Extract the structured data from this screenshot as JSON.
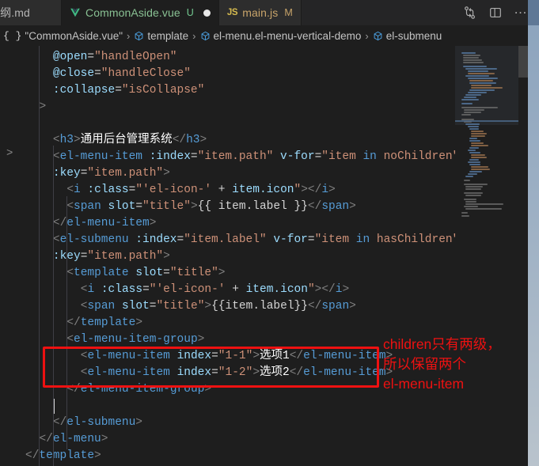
{
  "window": {
    "app": "Visual Studio Code",
    "theme_background": "#1e1e1e",
    "accent_red": "#ee1111"
  },
  "tabs": {
    "items": [
      {
        "label": "大纲.md",
        "icon": "markdown-icon",
        "badge": "",
        "dirty": false,
        "active": false,
        "truncated": true
      },
      {
        "label": "CommonAside.vue",
        "icon": "vue-icon",
        "badge": "U",
        "dirty": true,
        "active": true,
        "truncated": false
      },
      {
        "label": "main.js",
        "icon": "javascript-icon",
        "badge": "M",
        "dirty": false,
        "active": false,
        "truncated": false
      }
    ],
    "actions": [
      {
        "name": "split-editor-icon",
        "glyph": "split"
      },
      {
        "name": "toggle-panel-icon",
        "glyph": "panel"
      },
      {
        "name": "more-actions-icon",
        "glyph": "…"
      }
    ]
  },
  "breadcrumb": {
    "separator": "›",
    "items": [
      {
        "icon": "json-braces-icon",
        "label": "\"CommonAside.vue\""
      },
      {
        "icon": "symbol-module-icon",
        "label": "template"
      },
      {
        "icon": "symbol-module-icon",
        "label": "el-menu.el-menu-vertical-demo"
      },
      {
        "icon": "symbol-module-icon",
        "label": "el-submenu"
      }
    ]
  },
  "editor": {
    "language": "vue",
    "lines": [
      {
        "indent": 4,
        "tokens": [
          {
            "t": "attr",
            "s": "@open"
          },
          {
            "t": "plain",
            "s": "="
          },
          {
            "t": "str",
            "s": "\"handleOpen\""
          }
        ]
      },
      {
        "indent": 4,
        "tokens": [
          {
            "t": "attr",
            "s": "@close"
          },
          {
            "t": "plain",
            "s": "="
          },
          {
            "t": "str",
            "s": "\"handleClose\""
          }
        ]
      },
      {
        "indent": 4,
        "tokens": [
          {
            "t": "attr",
            "s": ":collapse"
          },
          {
            "t": "plain",
            "s": "="
          },
          {
            "t": "str",
            "s": "\"isCollapse\""
          }
        ]
      },
      {
        "indent": 2,
        "tokens": [
          {
            "t": "punc",
            "s": ">"
          }
        ]
      },
      {
        "indent": 0,
        "tokens": []
      },
      {
        "indent": 4,
        "tokens": [
          {
            "t": "punc",
            "s": "<"
          },
          {
            "t": "tag",
            "s": "h3"
          },
          {
            "t": "punc",
            "s": ">"
          },
          {
            "t": "text",
            "s": "通用后台管理系统"
          },
          {
            "t": "punc",
            "s": "</"
          },
          {
            "t": "tag",
            "s": "h3"
          },
          {
            "t": "punc",
            "s": ">"
          }
        ]
      },
      {
        "indent": 4,
        "tokens": [
          {
            "t": "punc",
            "s": "<"
          },
          {
            "t": "tag",
            "s": "el-menu-item"
          },
          {
            "t": "plain",
            "s": " "
          },
          {
            "t": "attr",
            "s": ":index"
          },
          {
            "t": "plain",
            "s": "="
          },
          {
            "t": "str",
            "s": "\"item.path\""
          },
          {
            "t": "plain",
            "s": " "
          },
          {
            "t": "attr",
            "s": "v-for"
          },
          {
            "t": "plain",
            "s": "="
          },
          {
            "t": "str",
            "s": "\"item "
          },
          {
            "t": "tag",
            "s": "in"
          },
          {
            "t": "str",
            "s": " noChildren\""
          }
        ]
      },
      {
        "indent": 4,
        "tokens": [
          {
            "t": "attr",
            "s": ":key"
          },
          {
            "t": "plain",
            "s": "="
          },
          {
            "t": "str",
            "s": "\"item.path\""
          },
          {
            "t": "punc",
            "s": ">"
          }
        ]
      },
      {
        "indent": 6,
        "tokens": [
          {
            "t": "punc",
            "s": "<"
          },
          {
            "t": "tag",
            "s": "i"
          },
          {
            "t": "plain",
            "s": " "
          },
          {
            "t": "attr",
            "s": ":class"
          },
          {
            "t": "plain",
            "s": "="
          },
          {
            "t": "str",
            "s": "\"'el-icon-'"
          },
          {
            "t": "plain",
            "s": " + "
          },
          {
            "t": "attr",
            "s": "item.icon"
          },
          {
            "t": "str",
            "s": "\""
          },
          {
            "t": "punc",
            "s": "></"
          },
          {
            "t": "tag",
            "s": "i"
          },
          {
            "t": "punc",
            "s": ">"
          }
        ]
      },
      {
        "indent": 6,
        "tokens": [
          {
            "t": "punc",
            "s": "<"
          },
          {
            "t": "tag",
            "s": "span"
          },
          {
            "t": "plain",
            "s": " "
          },
          {
            "t": "attr",
            "s": "slot"
          },
          {
            "t": "plain",
            "s": "="
          },
          {
            "t": "str",
            "s": "\"title\""
          },
          {
            "t": "punc",
            "s": ">"
          },
          {
            "t": "interp",
            "s": "{{ item.label }}"
          },
          {
            "t": "punc",
            "s": "</"
          },
          {
            "t": "tag",
            "s": "span"
          },
          {
            "t": "punc",
            "s": ">"
          }
        ]
      },
      {
        "indent": 4,
        "tokens": [
          {
            "t": "punc",
            "s": "</"
          },
          {
            "t": "tag",
            "s": "el-menu-item"
          },
          {
            "t": "punc",
            "s": ">"
          }
        ]
      },
      {
        "indent": 4,
        "tokens": [
          {
            "t": "punc",
            "s": "<"
          },
          {
            "t": "tag",
            "s": "el-submenu"
          },
          {
            "t": "plain",
            "s": " "
          },
          {
            "t": "attr",
            "s": ":index"
          },
          {
            "t": "plain",
            "s": "="
          },
          {
            "t": "str",
            "s": "\"item.label\""
          },
          {
            "t": "plain",
            "s": " "
          },
          {
            "t": "attr",
            "s": "v-for"
          },
          {
            "t": "plain",
            "s": "="
          },
          {
            "t": "str",
            "s": "\"item "
          },
          {
            "t": "tag",
            "s": "in"
          },
          {
            "t": "str",
            "s": " hasChildren\""
          }
        ]
      },
      {
        "indent": 4,
        "tokens": [
          {
            "t": "attr",
            "s": ":key"
          },
          {
            "t": "plain",
            "s": "="
          },
          {
            "t": "str",
            "s": "\"item.path\""
          },
          {
            "t": "punc",
            "s": ">"
          }
        ]
      },
      {
        "indent": 6,
        "tokens": [
          {
            "t": "punc",
            "s": "<"
          },
          {
            "t": "tag",
            "s": "template"
          },
          {
            "t": "plain",
            "s": " "
          },
          {
            "t": "attr",
            "s": "slot"
          },
          {
            "t": "plain",
            "s": "="
          },
          {
            "t": "str",
            "s": "\"title\""
          },
          {
            "t": "punc",
            "s": ">"
          }
        ]
      },
      {
        "indent": 8,
        "tokens": [
          {
            "t": "punc",
            "s": "<"
          },
          {
            "t": "tag",
            "s": "i"
          },
          {
            "t": "plain",
            "s": " "
          },
          {
            "t": "attr",
            "s": ":class"
          },
          {
            "t": "plain",
            "s": "="
          },
          {
            "t": "str",
            "s": "\"'el-icon-'"
          },
          {
            "t": "plain",
            "s": " + "
          },
          {
            "t": "attr",
            "s": "item.icon"
          },
          {
            "t": "str",
            "s": "\""
          },
          {
            "t": "punc",
            "s": "></"
          },
          {
            "t": "tag",
            "s": "i"
          },
          {
            "t": "punc",
            "s": ">"
          }
        ]
      },
      {
        "indent": 8,
        "tokens": [
          {
            "t": "punc",
            "s": "<"
          },
          {
            "t": "tag",
            "s": "span"
          },
          {
            "t": "plain",
            "s": " "
          },
          {
            "t": "attr",
            "s": "slot"
          },
          {
            "t": "plain",
            "s": "="
          },
          {
            "t": "str",
            "s": "\"title\""
          },
          {
            "t": "punc",
            "s": ">"
          },
          {
            "t": "interp",
            "s": "{{item.label}}"
          },
          {
            "t": "punc",
            "s": "</"
          },
          {
            "t": "tag",
            "s": "span"
          },
          {
            "t": "punc",
            "s": ">"
          }
        ]
      },
      {
        "indent": 6,
        "tokens": [
          {
            "t": "punc",
            "s": "</"
          },
          {
            "t": "tag",
            "s": "template"
          },
          {
            "t": "punc",
            "s": ">"
          }
        ]
      },
      {
        "indent": 6,
        "tokens": [
          {
            "t": "punc",
            "s": "<"
          },
          {
            "t": "tag",
            "s": "el-menu-item-group"
          },
          {
            "t": "punc",
            "s": ">"
          }
        ]
      },
      {
        "indent": 8,
        "highlight": true,
        "tokens": [
          {
            "t": "punc",
            "s": "<"
          },
          {
            "t": "tag",
            "s": "el-menu-item"
          },
          {
            "t": "plain",
            "s": " "
          },
          {
            "t": "attr",
            "s": "index"
          },
          {
            "t": "plain",
            "s": "="
          },
          {
            "t": "str",
            "s": "\"1-1\""
          },
          {
            "t": "punc",
            "s": ">"
          },
          {
            "t": "text",
            "s": "选项1"
          },
          {
            "t": "punc",
            "s": "</"
          },
          {
            "t": "tag",
            "s": "el-menu-item"
          },
          {
            "t": "punc",
            "s": ">"
          }
        ]
      },
      {
        "indent": 8,
        "highlight": true,
        "tokens": [
          {
            "t": "punc",
            "s": "<"
          },
          {
            "t": "tag",
            "s": "el-menu-item"
          },
          {
            "t": "plain",
            "s": " "
          },
          {
            "t": "attr",
            "s": "index"
          },
          {
            "t": "plain",
            "s": "="
          },
          {
            "t": "str",
            "s": "\"1-2\""
          },
          {
            "t": "punc",
            "s": ">"
          },
          {
            "t": "text",
            "s": "选项2"
          },
          {
            "t": "punc",
            "s": "</"
          },
          {
            "t": "tag",
            "s": "el-menu-item"
          },
          {
            "t": "punc",
            "s": ">"
          }
        ]
      },
      {
        "indent": 6,
        "tokens": [
          {
            "t": "punc",
            "s": "</"
          },
          {
            "t": "tag",
            "s": "el-menu-item-group"
          },
          {
            "t": "punc",
            "s": ">"
          }
        ]
      },
      {
        "indent": 0,
        "cursor": true,
        "tokens": []
      },
      {
        "indent": 4,
        "tokens": [
          {
            "t": "punc",
            "s": "</"
          },
          {
            "t": "tag",
            "s": "el-submenu"
          },
          {
            "t": "punc",
            "s": ">"
          }
        ]
      },
      {
        "indent": 2,
        "tokens": [
          {
            "t": "punc",
            "s": "</"
          },
          {
            "t": "tag",
            "s": "el-menu"
          },
          {
            "t": "punc",
            "s": ">"
          }
        ]
      },
      {
        "indent": 0,
        "tokens": [
          {
            "t": "punc",
            "s": "</"
          },
          {
            "t": "tag",
            "s": "template"
          },
          {
            "t": "punc",
            "s": ">"
          }
        ]
      }
    ],
    "fold_caret": ">"
  },
  "annotation": {
    "color": "#ee1111",
    "box_label": "highlighted-el-menu-item-lines",
    "lines": [
      "children只有两级，",
      "所以保留两个",
      "el-menu-item"
    ]
  },
  "colors": {
    "tag": "#569cd6",
    "attribute": "#9cdcfe",
    "string": "#ce9178",
    "punctuation": "#808080",
    "plain_text": "#d4d4d4",
    "chinese_text": "#ffffff",
    "tab_active_bg": "#1e1e1e",
    "tab_inactive_bg": "#2d2d2d",
    "tabbar_bg": "#252526"
  }
}
